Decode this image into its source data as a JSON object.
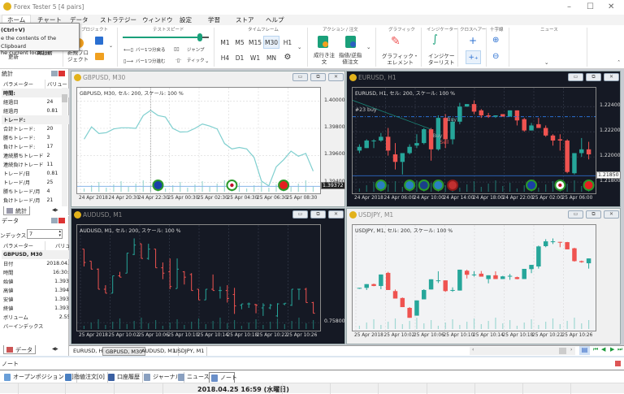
{
  "app": {
    "title": "Forex Tester 5  [4  pairs]"
  },
  "menu": {
    "tabs": [
      "ホーム",
      "チャート",
      "データ",
      "ストラテジー",
      "ウィンドウ",
      "設定",
      "学習",
      "ストア",
      "ヘルプ"
    ],
    "active": "ホーム"
  },
  "tooltip": {
    "lines": [
      "(Ctrl+V)",
      "e the contents of the Clipboard",
      "he current location."
    ]
  },
  "ribbon": {
    "refresh": "更新",
    "restart": "再起動",
    "project_group": "プロジェクト",
    "new_project": "新規プロ\nジェクト",
    "speed_group": "テストスピード",
    "speed_level": 0.9,
    "bar_back": "バー1つ分戻る",
    "bar_forward": "バー1つ分進む",
    "jump": "ジャンプ",
    "tick": "ティック",
    "timeframe_group": "タイムフレーム",
    "timeframes": [
      "M1",
      "M5",
      "M15",
      "M30",
      "H1",
      "H4",
      "D1",
      "W1",
      "MN"
    ],
    "active_timeframe": "M30",
    "action_group": "アクション / 注文",
    "market_order": "成行き注\n文",
    "pending_order": "指値/逆指\n値注文",
    "graphics_group": "グラフィック",
    "graphic_elements": "グラフィック・\nエレメント",
    "indicator_group": "インジケーター",
    "indicator_list": "インジケー\nターリスト",
    "crosshair_group": "クロスヘアー",
    "zoom_group": "十字線",
    "news_group": "ニュース"
  },
  "stats": {
    "title": "統計",
    "col_param": "パラメーター",
    "col_value": "バリュー",
    "rows": [
      {
        "label": "時間:",
        "value": "",
        "section": true
      },
      {
        "label": "経過日",
        "value": "24"
      },
      {
        "label": "経過月",
        "value": "0.81"
      },
      {
        "label": "トレード:",
        "value": "",
        "section": true
      },
      {
        "label": "合計トレード:",
        "value": "20"
      },
      {
        "label": "勝ちトレード:",
        "value": "3"
      },
      {
        "label": "負けトレード:",
        "value": "17"
      },
      {
        "label": "連続勝ちトレード",
        "value": "2"
      },
      {
        "label": "連続負けトレード",
        "value": "11"
      },
      {
        "label": "トレード/日",
        "value": "0.81"
      },
      {
        "label": "トレード/月",
        "value": "25"
      },
      {
        "label": "勝ちトレード/月",
        "value": "4"
      },
      {
        "label": "負けトレード/月",
        "value": "21"
      }
    ],
    "tab": "統計"
  },
  "datapanel": {
    "title": "データ",
    "index_label": "ンデックス:",
    "index_value": "7",
    "col_param": "パラメーター",
    "col_value": "バリュー",
    "section": "GBPUSD, M30",
    "rows": [
      {
        "label": "日付",
        "value": "2018.04.25"
      },
      {
        "label": "時間",
        "value": "16:30:00"
      },
      {
        "label": "始値",
        "value": "1.39377"
      },
      {
        "label": "高値",
        "value": "1.39481"
      },
      {
        "label": "安値",
        "value": "1.39371"
      },
      {
        "label": "終値",
        "value": "1.39372"
      },
      {
        "label": "ボリューム",
        "value": "2.55 B"
      },
      {
        "label": "バーインデックス",
        "value": "0"
      }
    ],
    "tab": "データ"
  },
  "colors": {
    "bull": "#26a69a",
    "bear": "#ef5350",
    "line": "#7fcfcf",
    "dark_bg": "#151924",
    "light_bg": "#ffffff"
  },
  "chart_data": [
    {
      "id": "gbpusd",
      "title": "GBPUSD, M30",
      "info": "GBPUSD, M30, セル: 200, スケール: 100 %",
      "type": "line",
      "theme": "light",
      "ylim": [
        1.3932,
        1.401
      ],
      "price_ticks": [
        "1.40000",
        "1.39800",
        "1.39600",
        "1.39400"
      ],
      "current_price": "1.39372",
      "time_labels": [
        "24 Apr 2018",
        "24 Apr 20:30",
        "24 Apr 22:30",
        "25 Apr 00:30",
        "25 Apr 02:30",
        "25 Apr 04:30",
        "25 Apr 06:30",
        "25 Apr 08:30"
      ],
      "values": [
        1.3972,
        1.39811,
        1.39762,
        1.39768,
        1.39796,
        1.39804,
        1.39804,
        1.398,
        1.39895,
        1.39933,
        1.39895,
        1.39884,
        1.398,
        1.39773,
        1.39775,
        1.398,
        1.39832,
        1.39817,
        1.39796,
        1.39688,
        1.39648,
        1.39659,
        1.39648,
        1.39585,
        1.39411,
        1.39375,
        1.39516,
        1.39568,
        1.39632,
        1.39594,
        1.39615,
        1.39484
      ],
      "events": [
        {
          "at": 10,
          "icon": "eu-flag-icon"
        },
        {
          "at": 20,
          "icon": "jp-flag-icon"
        },
        {
          "at": 27,
          "icon": "ch-flag-icon"
        }
      ]
    },
    {
      "id": "eurusd",
      "title": "EURUSD, H1",
      "info": "EURUSD, H1, セル: 200, スケール: 100 %",
      "type": "candlestick",
      "theme": "dark",
      "ylim": [
        1.2171,
        1.2255
      ],
      "price_ticks": [
        "1.22400",
        "1.22200",
        "1.22000",
        "1.21800"
      ],
      "current_price": "1.21850",
      "order_line": {
        "label": "#23 buy",
        "price": 1.2232
      },
      "trade_labels": [
        "Buy",
        "Buy",
        "Sell"
      ],
      "time_labels": [
        "24 Apr 2018",
        "24 Apr 06:00",
        "24 Apr 10:00",
        "24 Apr 14:00",
        "24 Apr 18:00",
        "24 Apr 22:00",
        "25 Apr 02:00",
        "25 Apr 06:00"
      ],
      "ohlc": [
        [
          1.2205,
          1.221,
          1.2203,
          1.2208
        ],
        [
          1.2207,
          1.2214,
          1.2207,
          1.2213
        ],
        [
          1.2213,
          1.2214,
          1.2207,
          1.2213
        ],
        [
          1.2213,
          1.2219,
          1.2212,
          1.2216
        ],
        [
          1.2216,
          1.2223,
          1.2201,
          1.2205
        ],
        [
          1.2202,
          1.2211,
          1.219,
          1.2196
        ],
        [
          1.2196,
          1.2203,
          1.2186,
          1.2203
        ],
        [
          1.2203,
          1.221,
          1.2202,
          1.2208
        ],
        [
          1.2209,
          1.2218,
          1.2207,
          1.2211
        ],
        [
          1.2211,
          1.2223,
          1.221,
          1.2222
        ],
        [
          1.2222,
          1.2223,
          1.2197,
          1.2206
        ],
        [
          1.2206,
          1.2233,
          1.2205,
          1.2231
        ],
        [
          1.2231,
          1.2234,
          1.2207,
          1.2214
        ],
        [
          1.2214,
          1.2231,
          1.221,
          1.2228
        ],
        [
          1.2228,
          1.2243,
          1.2226,
          1.224
        ],
        [
          1.224,
          1.2242,
          1.224,
          1.2242
        ],
        [
          1.2242,
          1.2245,
          1.2234,
          1.2236
        ],
        [
          1.2237,
          1.2238,
          1.2231,
          1.2233
        ],
        [
          1.2233,
          1.2235,
          1.2231,
          1.2232
        ],
        [
          1.2232,
          1.2233,
          1.2231,
          1.2233
        ],
        [
          1.2234,
          1.2234,
          1.2232,
          1.2232
        ],
        [
          1.2232,
          1.2237,
          1.2232,
          1.2237
        ],
        [
          1.2237,
          1.2237,
          1.2225,
          1.2229
        ],
        [
          1.223,
          1.2231,
          1.222,
          1.2221
        ],
        [
          1.2221,
          1.2227,
          1.2221,
          1.2225
        ],
        [
          1.2226,
          1.2231,
          1.2223,
          1.2223
        ],
        [
          1.2223,
          1.2225,
          1.2216,
          1.2217
        ],
        [
          1.2217,
          1.2218,
          1.2209,
          1.2213
        ],
        [
          1.2214,
          1.2218,
          1.2205,
          1.2213
        ],
        [
          1.2213,
          1.2214,
          1.2187,
          1.2188
        ],
        [
          1.2187,
          1.2203,
          1.2186,
          1.2203
        ],
        [
          1.2203,
          1.2215,
          1.22,
          1.2206
        ],
        [
          1.2206,
          1.2212,
          1.2198,
          1.2202
        ]
      ],
      "events": [
        {
          "at": 3,
          "icon": "globe-icon"
        },
        {
          "at": 7,
          "icon": "globe-icon"
        },
        {
          "at": 9,
          "icon": "uk-flag-icon"
        },
        {
          "at": 11,
          "icon": "globe-icon"
        },
        {
          "at": 13,
          "icon": "us-flag-icon"
        },
        {
          "at": 24,
          "icon": "eu-flag-icon"
        },
        {
          "at": 28,
          "icon": "jp-flag-icon"
        },
        {
          "at": 32,
          "icon": "ch-flag-icon"
        }
      ]
    },
    {
      "id": "audusd",
      "title": "AUDUSD, M1",
      "info": "AUDUSD, M1, セル: 200, スケール: 100 %",
      "type": "ohlc-bar",
      "theme": "dark",
      "ylim": [
        0.75788,
        0.75946
      ],
      "price_ticks": [
        "0.75800"
      ],
      "time_labels": [
        "25 Apr 2018",
        "25 Apr 10:02",
        "25 Apr 10:06",
        "25 Apr 10:10",
        "25 Apr 10:14",
        "25 Apr 10:18",
        "25 Apr 10:22",
        "25 Apr 10:26"
      ],
      "ohlc": [
        [
          0.7591,
          0.7591,
          0.75884,
          0.7589
        ],
        [
          0.75892,
          0.75892,
          0.7588,
          0.7588
        ],
        [
          0.7588,
          0.75881,
          0.7585,
          0.7585
        ],
        [
          0.7585,
          0.75856,
          0.75844,
          0.75844
        ],
        [
          0.75844,
          0.7587,
          0.75844,
          0.7587
        ],
        [
          0.7587,
          0.75876,
          0.75868,
          0.75868
        ],
        [
          0.75874,
          0.75904,
          0.75874,
          0.75904
        ],
        [
          0.75902,
          0.75926,
          0.75901,
          0.75916
        ],
        [
          0.75918,
          0.75918,
          0.75896,
          0.75896
        ],
        [
          0.75896,
          0.75918,
          0.75894,
          0.7591
        ],
        [
          0.7591,
          0.7591,
          0.75882,
          0.75882
        ],
        [
          0.75882,
          0.7589,
          0.75865,
          0.75874
        ],
        [
          0.75876,
          0.75896,
          0.7585,
          0.75854
        ],
        [
          0.75851,
          0.75896,
          0.75851,
          0.7588
        ],
        [
          0.75876,
          0.75877,
          0.75857,
          0.75868
        ],
        [
          0.75872,
          0.75874,
          0.75848,
          0.75848
        ],
        [
          0.7585,
          0.7585,
          0.75834,
          0.75834
        ],
        [
          0.75834,
          0.7585,
          0.75834,
          0.7585
        ],
        [
          0.7585,
          0.75872,
          0.75848,
          0.75848
        ],
        [
          0.75848,
          0.75854,
          0.75836,
          0.75848
        ],
        [
          0.75848,
          0.75856,
          0.7583,
          0.75836
        ],
        [
          0.75842,
          0.75852,
          0.75813,
          0.75825
        ],
        [
          0.75826,
          0.75828,
          0.7582,
          0.75828
        ],
        [
          0.75828,
          0.7583,
          0.75822,
          0.75828
        ],
        [
          0.75827,
          0.75828,
          0.75814,
          0.75826
        ],
        [
          0.75822,
          0.75829,
          0.7581,
          0.75826
        ],
        [
          0.75822,
          0.75828,
          0.7582,
          0.75826
        ],
        [
          0.7581,
          0.75829,
          0.75808,
          0.75828
        ],
        [
          0.75828,
          0.75829,
          0.75826,
          0.75829
        ],
        [
          0.75826,
          0.7585,
          0.75825,
          0.7585
        ],
        [
          0.7585,
          0.7585,
          0.75834,
          0.7585
        ],
        [
          0.7585,
          0.75852,
          0.7583,
          0.7583
        ],
        [
          0.7583,
          0.75831,
          0.75814,
          0.75814
        ]
      ]
    },
    {
      "id": "usdjpy",
      "title": "USDJPY, M1",
      "info": "USDJPY, M1, セル: 200, スケール: 100 %",
      "type": "candlestick",
      "theme": "light",
      "ylim": [
        108.65,
        109.045
      ],
      "price_ticks": [],
      "time_labels": [
        "25 Apr 2018",
        "25 Apr 10:02",
        "25 Apr 10:06",
        "25 Apr 10:10",
        "25 Apr 10:14",
        "25 Apr 10:18",
        "25 Apr 10:22",
        "25 Apr 10:26"
      ],
      "ohlc": [
        [
          108.808,
          108.81,
          108.806,
          108.81
        ],
        [
          108.81,
          108.824,
          108.802,
          108.824
        ],
        [
          108.824,
          108.826,
          108.816,
          108.817
        ],
        [
          108.817,
          108.86,
          108.805,
          108.86
        ],
        [
          108.866,
          108.87,
          108.802,
          108.802
        ],
        [
          108.798,
          108.804,
          108.77,
          108.77
        ],
        [
          108.772,
          108.774,
          108.738,
          108.738
        ],
        [
          108.735,
          108.738,
          108.698,
          108.698
        ],
        [
          108.706,
          108.763,
          108.706,
          108.763
        ],
        [
          108.767,
          108.805,
          108.767,
          108.802
        ],
        [
          108.804,
          108.842,
          108.804,
          108.842
        ],
        [
          108.838,
          108.872,
          108.828,
          108.838
        ],
        [
          108.838,
          108.838,
          108.795,
          108.798
        ],
        [
          108.8,
          108.812,
          108.795,
          108.802
        ],
        [
          108.8,
          108.878,
          108.8,
          108.878
        ],
        [
          108.874,
          108.878,
          108.845,
          108.859
        ],
        [
          108.86,
          108.872,
          108.852,
          108.86
        ],
        [
          108.863,
          108.873,
          108.852,
          108.852
        ],
        [
          108.843,
          108.857,
          108.827,
          108.857
        ],
        [
          108.857,
          108.872,
          108.843,
          108.843
        ],
        [
          108.843,
          108.855,
          108.843,
          108.853
        ],
        [
          108.853,
          108.862,
          108.84,
          108.855
        ],
        [
          108.85,
          108.852,
          108.842,
          108.843
        ],
        [
          108.843,
          108.881,
          108.843,
          108.881
        ],
        [
          108.88,
          108.896,
          108.865,
          108.896
        ],
        [
          108.89,
          108.968,
          108.882,
          108.965
        ],
        [
          108.966,
          108.992,
          108.962,
          108.984
        ],
        [
          108.984,
          108.995,
          108.974,
          108.984
        ],
        [
          108.982,
          108.982,
          108.962,
          108.98
        ],
        [
          108.981,
          108.982,
          108.954,
          108.954
        ],
        [
          108.958,
          108.96,
          108.908,
          108.91
        ],
        [
          108.91,
          108.912,
          108.904,
          108.906
        ],
        [
          108.902,
          108.92,
          108.882,
          108.92
        ]
      ]
    }
  ],
  "doc_tabs": {
    "items": [
      "EURUSD, H1",
      "GBPUSD, M30",
      "AUDUSD, M1",
      "USDJPY, M1"
    ],
    "active": "GBPUSD, M30"
  },
  "note": {
    "title": "ノート"
  },
  "bottom_tabs": {
    "items": [
      "オープンポジション [1]",
      "指値注文[0]",
      "口座履歴",
      "ジャーナル",
      "ニュース",
      "ノート"
    ],
    "active": "ノート"
  },
  "status": {
    "datetime": "2018.04.25 16:59 (水曜日)"
  }
}
